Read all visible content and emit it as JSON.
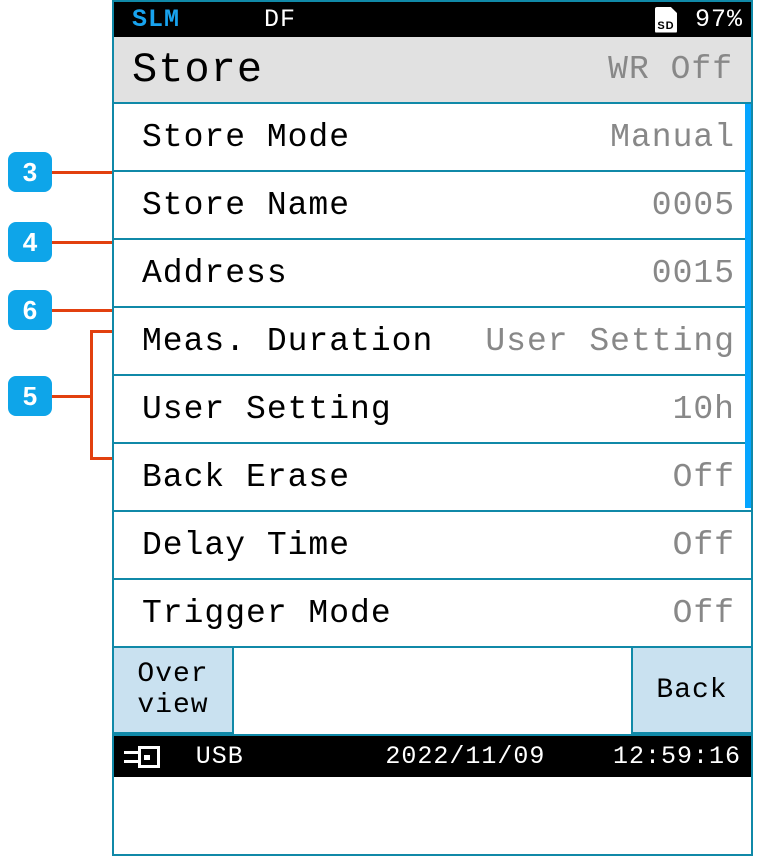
{
  "callouts": {
    "c3": "3",
    "c4": "4",
    "c5": "5",
    "c6": "6"
  },
  "topbar": {
    "mode": "SLM",
    "right_mode": "DF",
    "battery": "97%"
  },
  "title": {
    "text": "Store",
    "wr": "WR Off"
  },
  "rows": [
    {
      "label": "Store Mode",
      "value": "Manual"
    },
    {
      "label": "Store Name",
      "value": "0005"
    },
    {
      "label": "Address",
      "value": "0015"
    },
    {
      "label": "Meas. Duration",
      "value": "User Setting"
    },
    {
      "label": "User Setting",
      "value": "10h"
    },
    {
      "label": "Back Erase",
      "value": "Off"
    },
    {
      "label": "Delay Time",
      "value": "Off"
    },
    {
      "label": "Trigger Mode",
      "value": "Off"
    }
  ],
  "buttons": {
    "left1": "Over",
    "left2": "view",
    "right": "Back"
  },
  "bottombar": {
    "usb": "USB",
    "date": "2022/11/09",
    "time": "12:59:16"
  }
}
